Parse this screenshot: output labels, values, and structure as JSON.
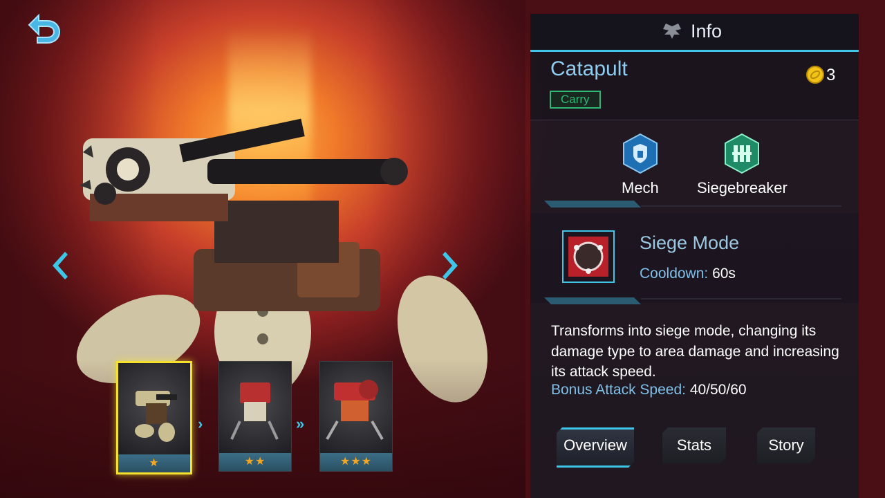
{
  "panel": {
    "title": "Info",
    "mech_name": "Catapult",
    "role": "Carry",
    "cost": "3"
  },
  "traits": [
    {
      "label": "Mech",
      "icon": "shield-icon",
      "color": "#1f6fb5"
    },
    {
      "label": "Siegebreaker",
      "icon": "siegebreaker-icon",
      "color": "#1f8a66"
    }
  ],
  "skill": {
    "name": "Siege Mode",
    "cooldown_label": "Cooldown:",
    "cooldown_value": "60s",
    "description": "Transforms into siege mode, changing its damage type to area damage and increasing its attack speed.",
    "bonus_label": "Bonus Attack Speed:",
    "bonus_value": "40/50/60"
  },
  "evolutions": [
    {
      "stars": "★",
      "selected": true
    },
    {
      "stars": "★★",
      "selected": false
    },
    {
      "stars": "★★★",
      "selected": false
    }
  ],
  "tabs": [
    "Overview",
    "Stats",
    "Story"
  ],
  "active_tab": "Overview",
  "colors": {
    "accent": "#3ec6e8",
    "role": "#2fb874",
    "selected": "#f3e12e"
  }
}
